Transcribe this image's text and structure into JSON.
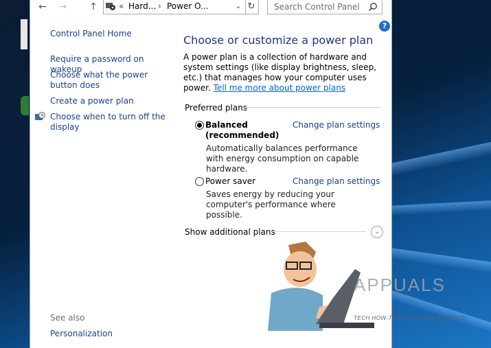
{
  "window": {
    "breadcrumb": [
      "Hard...",
      "Power O..."
    ],
    "breadcrumb_overflow": "«",
    "search_placeholder": "Search Control Panel"
  },
  "icons": {
    "back": "arrow-left-icon",
    "forward": "arrow-right-icon",
    "up": "arrow-up-icon",
    "refresh": "refresh-icon",
    "search": "search-icon",
    "help": "help-icon",
    "expand": "chevron-down-icon"
  },
  "left_pane": {
    "home": "Control Panel Home",
    "links": [
      "Require a password on wakeup",
      "Choose what the power button does",
      "Create a power plan",
      "Choose when to turn off the display"
    ],
    "see_also_label": "See also",
    "see_also": [
      "Personalization"
    ]
  },
  "main": {
    "title": "Choose or customize a power plan",
    "description": "A power plan is a collection of hardware and system settings (like display brightness, sleep, etc.) that manages how your computer uses power.",
    "description_link": "Tell me more about power plans",
    "preferred_label": "Preferred plans",
    "plans": [
      {
        "name": "Balanced",
        "sub": "(recommended)",
        "selected": true,
        "link": "Change plan settings",
        "description": "Automatically balances performance with energy consumption on capable hardware."
      },
      {
        "name": "Power saver",
        "selected": false,
        "link": "Change plan settings",
        "description": "Saves energy by reducing your computer's performance where possible."
      }
    ],
    "additional": "Show additional plans"
  },
  "watermark": {
    "brand": "APPUALS",
    "tagline": "TECH HOW-TO'S FROM THE EXPERTS!"
  },
  "colors": {
    "link": "#1b3f95",
    "title": "#1e3287",
    "help": "#1a6fc9"
  }
}
